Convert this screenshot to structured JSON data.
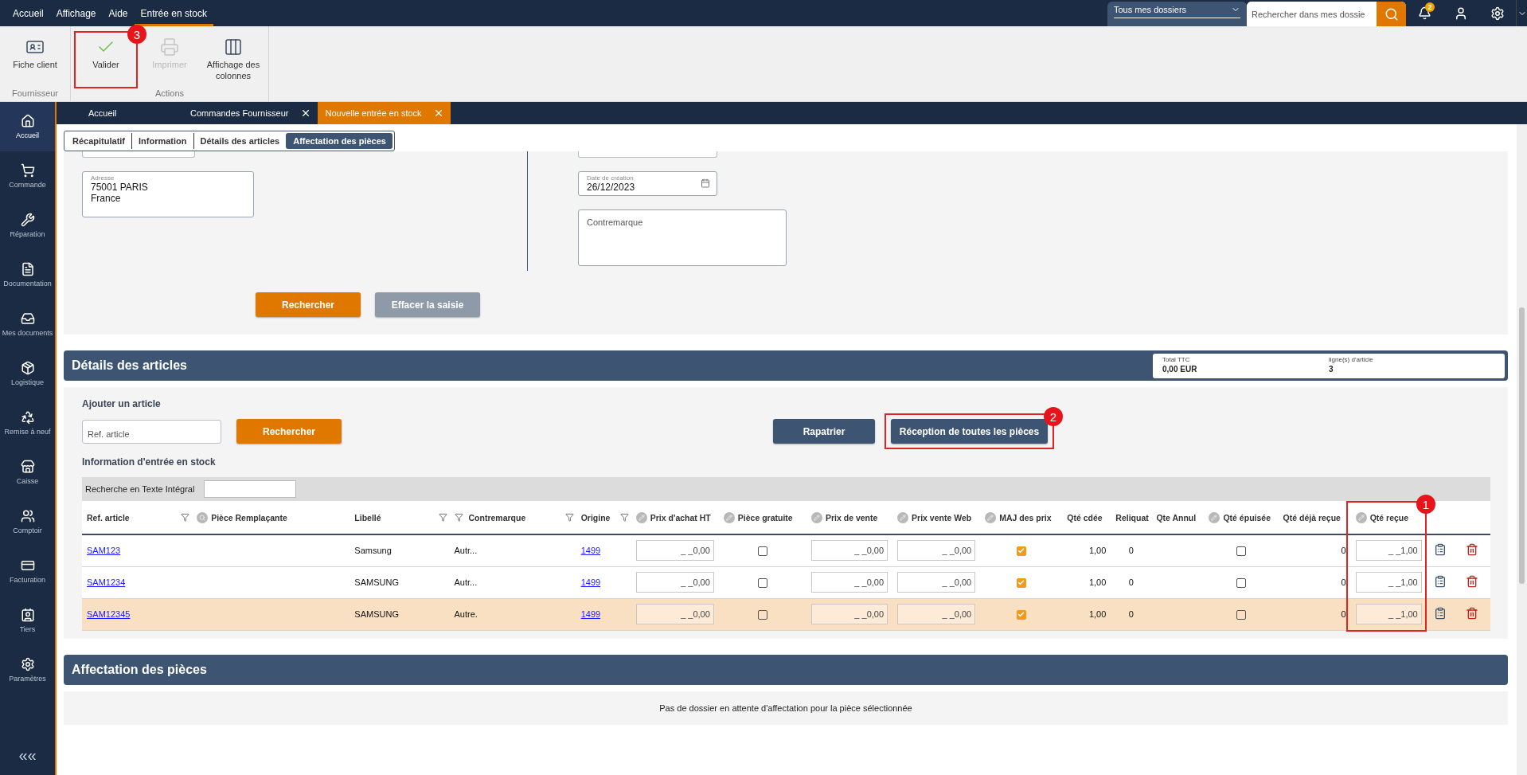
{
  "menu": [
    {
      "label": "Accueil",
      "selected": false
    },
    {
      "label": "Affichage",
      "selected": false
    },
    {
      "label": "Aide",
      "selected": false
    },
    {
      "label": "Entrée en stock",
      "selected": true
    }
  ],
  "folder_select": {
    "value": "Tous mes dossiers"
  },
  "global_search": {
    "placeholder": "Rechercher dans mes dossie"
  },
  "notifications": {
    "count": "2"
  },
  "ribbon": [
    {
      "group": "Fournisseur",
      "items": [
        {
          "label": "Fiche client",
          "disabled": false
        }
      ]
    },
    {
      "group": "Actions",
      "items": [
        {
          "label": "Valider",
          "disabled": false,
          "annotation": "3"
        },
        {
          "label": "Imprimer",
          "disabled": true
        },
        {
          "label": "Affichage des colonnes",
          "disabled": false
        }
      ]
    }
  ],
  "sidebar": {
    "items": [
      {
        "label": "Accueil",
        "selected": true
      },
      {
        "label": "Commande",
        "selected": false
      },
      {
        "label": "Réparation",
        "selected": false
      },
      {
        "label": "Documentation",
        "selected": false
      },
      {
        "label": "Mes documents",
        "selected": false
      },
      {
        "label": "Logistique",
        "selected": false
      },
      {
        "label": "Remise à neuf",
        "selected": false
      },
      {
        "label": "Caisse",
        "selected": false
      },
      {
        "label": "Comptoir",
        "selected": false
      },
      {
        "label": "Facturation",
        "selected": false
      },
      {
        "label": "Tiers",
        "selected": false
      },
      {
        "label": "Paramètres",
        "selected": false
      }
    ],
    "collapse": "«"
  },
  "doc_tabs": [
    {
      "label": "Accueil",
      "closable": false,
      "selected": false
    },
    {
      "label": "Commandes Fournisseur",
      "closable": true,
      "selected": false
    },
    {
      "label": "Nouvelle entrée en stock",
      "closable": true,
      "selected": true
    }
  ],
  "section_tabs": [
    {
      "label": "Récapitulatif",
      "selected": false
    },
    {
      "label": "Information",
      "selected": false
    },
    {
      "label": "Détails des articles",
      "selected": false
    },
    {
      "label": "Affectation des pièces",
      "selected": true
    }
  ],
  "form": {
    "address": {
      "label": "Adresse",
      "lines": [
        "75001 PARIS",
        "France"
      ]
    },
    "creation_date": {
      "label": "Date de création",
      "value": "26/12/2023"
    },
    "contremarque": {
      "placeholder": "Contremarque"
    },
    "buttons": [
      {
        "label": "Rechercher",
        "disabled": false
      },
      {
        "label": "Effacer la saisie",
        "disabled": true
      }
    ]
  },
  "details": {
    "title": "Détails des articles",
    "totals": [
      {
        "label": "Total TTC",
        "value": "0,00 EUR"
      },
      {
        "label": "ligne(s) d'article",
        "value": "3"
      }
    ],
    "add_title": "Ajouter un article",
    "ref_field": {
      "placeholder": "Ref. article"
    },
    "search_button": "Rechercher",
    "actions": [
      {
        "label": "Rapatrier"
      },
      {
        "label": "Réception de toutes les pièces",
        "annotation": "2"
      }
    ],
    "stock_title": "Information d'entrée en stock",
    "fulltext_label": "Recherche en Texte Intégral",
    "columns": [
      {
        "label": "Ref. article",
        "kind": "plain",
        "filter": true
      },
      {
        "label": "Pièce Remplaçante",
        "kind": "search",
        "filter": false
      },
      {
        "label": "Libellé",
        "kind": "plain",
        "filter": true
      },
      {
        "kind": "plain",
        "filter": true
      },
      {
        "label": "Contremarque",
        "kind": "plain",
        "filter": true
      },
      {
        "label": "Origine",
        "kind": "plain",
        "filter": true
      },
      {
        "label": "Prix d'achat HT",
        "kind": "edit",
        "filter": false
      },
      {
        "label": "Pièce gratuite",
        "kind": "edit",
        "filter": false
      },
      {
        "label": "Prix de vente",
        "kind": "edit",
        "filter": false
      },
      {
        "label": "Prix vente Web",
        "kind": "edit",
        "filter": false
      },
      {
        "label": "MAJ des prix",
        "kind": "edit",
        "filter": false
      },
      {
        "label": "Qté cdée",
        "kind": "plain",
        "filter": false
      },
      {
        "label": "Reliquat",
        "kind": "plain",
        "filter": false
      },
      {
        "label": "Qte Annul",
        "kind": "plain",
        "filter": false
      },
      {
        "label": "Qté épuisée",
        "kind": "edit",
        "filter": false
      },
      {
        "label": "Qté déjà reçue",
        "kind": "plain",
        "filter": false
      },
      {
        "label": "Qté reçue",
        "kind": "edit",
        "filter": false,
        "annotation": "1"
      }
    ],
    "rows": [
      {
        "ref": "SAM123",
        "libelle": "Samsung",
        "column_4": "Autr...",
        "origine": "1499",
        "prix_achat": "_ _0,00",
        "piece_gratuite": false,
        "prix_vente": "_ _0,00",
        "prix_web": "_ _0,00",
        "maj_prix": true,
        "qte_cdee": "1,00",
        "reliquat": "0",
        "qte_epuisee": false,
        "qte_deja_recue": "0",
        "qte_recue": "_ _1,00",
        "selected": false
      },
      {
        "ref": "SAM1234",
        "libelle": "SAMSUNG",
        "column_4": "Autr...",
        "origine": "1499",
        "prix_achat": "_ _0,00",
        "piece_gratuite": false,
        "prix_vente": "_ _0,00",
        "prix_web": "_ _0,00",
        "maj_prix": true,
        "qte_cdee": "1,00",
        "reliquat": "0",
        "qte_epuisee": false,
        "qte_deja_recue": "0",
        "qte_recue": "_ _1,00",
        "selected": false
      },
      {
        "ref": "SAM12345",
        "libelle": "SAMSUNG",
        "column_4": "Autre.",
        "origine": "1499",
        "prix_achat": "_ _0,00",
        "piece_gratuite": false,
        "prix_vente": "_ _0,00",
        "prix_web": "_ _0,00",
        "maj_prix": true,
        "qte_cdee": "1,00",
        "reliquat": "0",
        "qte_epuisee": false,
        "qte_deja_recue": "0",
        "qte_recue": "_ _1,00",
        "selected": true
      }
    ]
  },
  "assignment": {
    "title": "Affectation des pièces",
    "message": "Pas de dossier en attente d'affectation pour la pièce sélectionnée"
  }
}
